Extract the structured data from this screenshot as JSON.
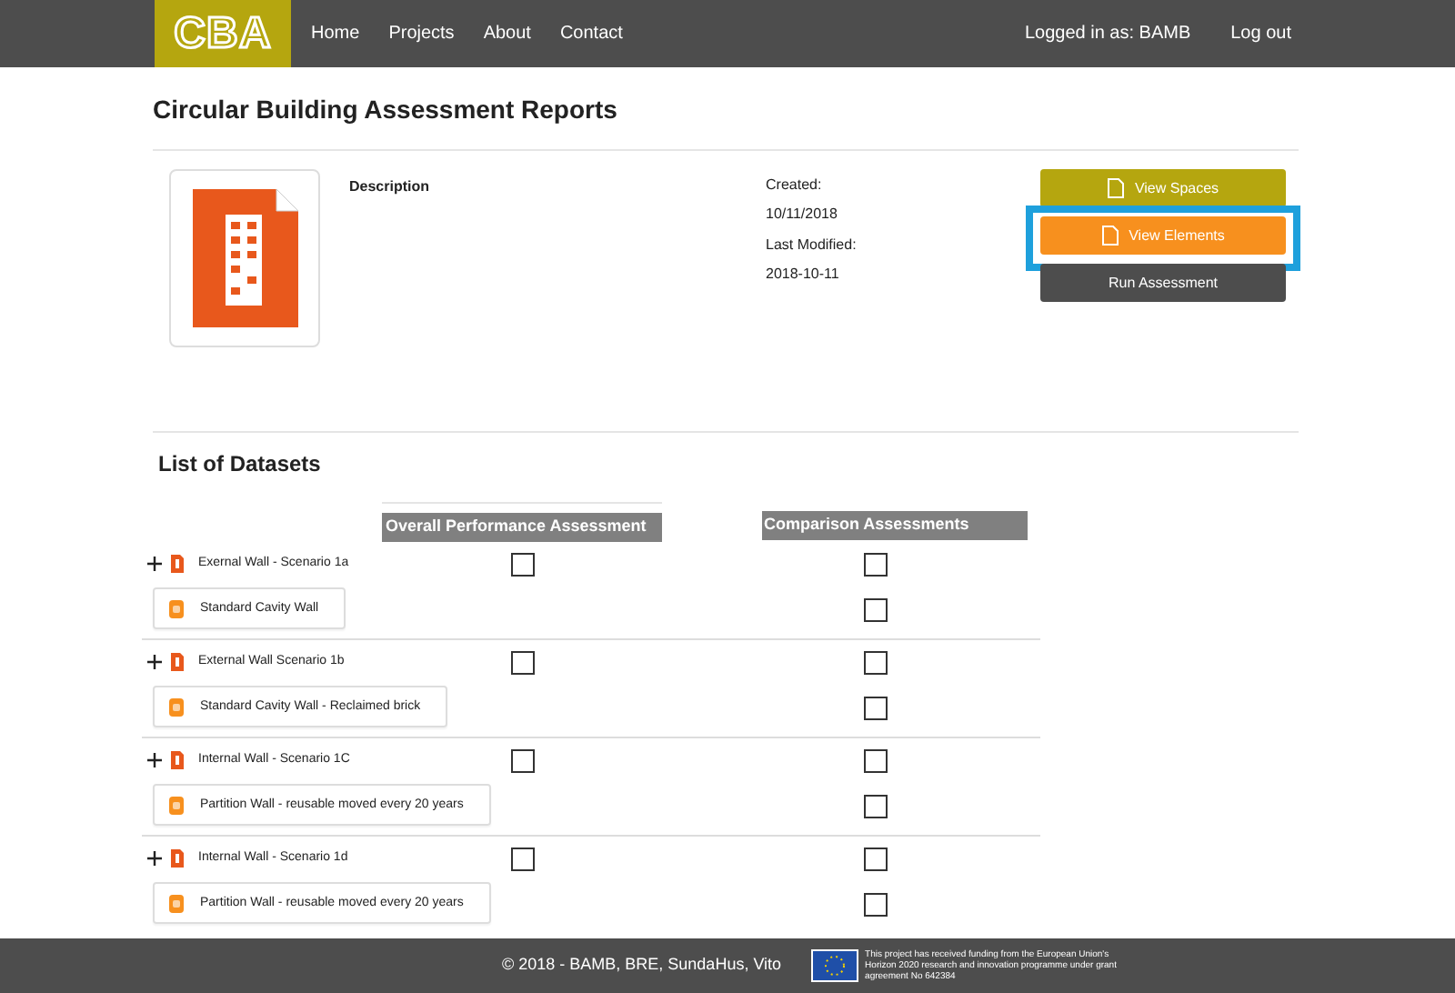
{
  "nav": {
    "logo": "CBA",
    "links": [
      "Home",
      "Projects",
      "About",
      "Contact"
    ],
    "user": "Logged in as: BAMB",
    "logout": "Log out"
  },
  "title": "Circular Building Assessment Reports",
  "report": {
    "description_label": "Description",
    "created_label": "Created:",
    "created": "10/11/2018",
    "modified_label": "Last Modified:",
    "modified": "2018-10-11",
    "buttons": [
      {
        "kind": "spaces",
        "label": "View Spaces",
        "highlighted": false
      },
      {
        "kind": "elements",
        "label": "View Elements",
        "highlighted": true
      },
      {
        "kind": "run",
        "label": "Run Assessment",
        "highlighted": false
      }
    ]
  },
  "datasets_title": "List of Datasets",
  "columns": [
    "Overall Performance Assessment",
    "Comparison Assessments"
  ],
  "datasets": [
    {
      "name": "Exernal Wall - Scenario 1a",
      "overall_checked": false,
      "comparison_checked": false,
      "children": [
        {
          "name": "Standard Cavity Wall",
          "comparison_checked": false
        }
      ]
    },
    {
      "name": "External Wall Scenario 1b",
      "overall_checked": false,
      "comparison_checked": false,
      "children": [
        {
          "name": "Standard Cavity Wall - Reclaimed brick",
          "comparison_checked": false
        }
      ]
    },
    {
      "name": "Internal Wall - Scenario 1C",
      "overall_checked": false,
      "comparison_checked": false,
      "children": [
        {
          "name": "Partition Wall - reusable moved every 20 years",
          "comparison_checked": false
        }
      ]
    },
    {
      "name": "Internal Wall - Scenario 1d",
      "overall_checked": false,
      "comparison_checked": false,
      "children": [
        {
          "name": "Partition Wall - reusable moved every 20 years",
          "comparison_checked": false
        }
      ]
    }
  ],
  "footer": {
    "copyright": "© 2018 - BAMB, BRE, SundaHus, Vito",
    "funding": "This project has received funding from the European Union's Horizon 2020 research and innovation programme under grant agreement No 642384"
  }
}
